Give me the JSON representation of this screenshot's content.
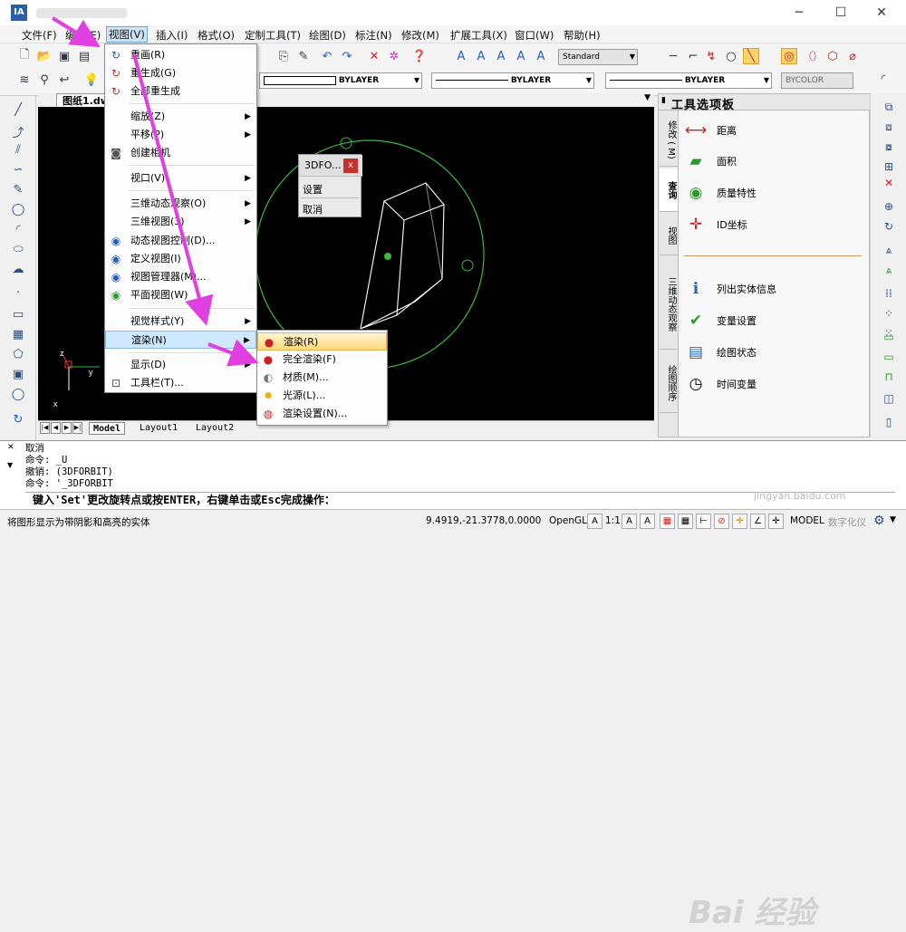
{
  "titlebar": {
    "logo": "IA",
    "min": "─",
    "max": "☐",
    "close": "✕"
  },
  "menubar": [
    "文件(F)",
    "编辑(E)",
    "视图(V)",
    "插入(I)",
    "格式(O)",
    "定制工具(T)",
    "绘图(D)",
    "标注(N)",
    "修改(M)",
    "扩展工具(X)",
    "窗口(W)",
    "帮助(H)"
  ],
  "toolbar": {
    "text_style": "Standard",
    "layer1": "BYLAYER",
    "layer2": "BYLAYER",
    "layer3": "BYLAYER",
    "color": "BYCOLOR"
  },
  "document_tab": "图纸1.dw",
  "view_menu": [
    {
      "label": "重画(R)",
      "icon": "redraw-icon"
    },
    {
      "label": "重生成(G)",
      "icon": "regen-icon"
    },
    {
      "label": "全部重生成",
      "icon": "regen-all-icon"
    },
    {
      "label": "缩放(Z)",
      "icon": "",
      "submenu": true
    },
    {
      "label": "平移(P)",
      "icon": "",
      "submenu": true
    },
    {
      "label": "创建相机",
      "icon": "camera-icon"
    },
    {
      "label": "视口(V)",
      "icon": "",
      "submenu": true
    },
    {
      "label": "三维动态观察(O)",
      "icon": "",
      "submenu": true
    },
    {
      "label": "三维视图(3)",
      "icon": "",
      "submenu": true
    },
    {
      "label": "动态视图控制(D)...",
      "icon": "dynamic-view-icon"
    },
    {
      "label": "定义视图(I)",
      "icon": "define-view-icon"
    },
    {
      "label": "视图管理器(M)...",
      "icon": "view-manager-icon"
    },
    {
      "label": "平面视图(W)",
      "icon": "plan-view-icon"
    },
    {
      "label": "视觉样式(Y)",
      "icon": "",
      "submenu": true
    },
    {
      "label": "渲染(N)",
      "icon": "",
      "submenu": true
    },
    {
      "label": "显示(D)",
      "icon": "",
      "submenu": true
    },
    {
      "label": "工具栏(T)...",
      "icon": "toolbar-icon"
    }
  ],
  "render_submenu": [
    {
      "label": "渲染(R)",
      "icon": "render-icon"
    },
    {
      "label": "完全渲染(F)",
      "icon": "full-render-icon"
    },
    {
      "label": "材质(M)...",
      "icon": "material-icon"
    },
    {
      "label": "光源(L)...",
      "icon": "light-icon"
    },
    {
      "label": "渲染设置(N)...",
      "icon": "render-settings-icon"
    }
  ],
  "popup": {
    "title": "3DFO...",
    "close": "x",
    "items": [
      "设置",
      "取消"
    ]
  },
  "palette": {
    "title": "工具选项板",
    "tabs": [
      "修改 ( M)",
      "查询",
      "视图",
      "三维动态观察",
      "绘图顺序"
    ],
    "items": [
      "距离",
      "面积",
      "质量特性",
      "ID坐标",
      "列出实体信息",
      "变量设置",
      "绘图状态",
      "时间变量"
    ]
  },
  "layout_tabs": [
    "Model",
    "Layout1",
    "Layout2"
  ],
  "command_history": [
    "取消",
    "命令: _U",
    "撤销: (3DFORBIT)",
    "命令: '_3DFORBIT"
  ],
  "prompt": "键入'Set'更改旋转点或按ENTER，右键单击或Esc完成操作：",
  "status": {
    "message": "将图形显示为带阴影和高亮的实体",
    "coords": "9.4919,-21.3778,0.0000",
    "opengl": "OpenGL",
    "scale": "1:1",
    "model": "MODEL",
    "digitize": "数字化仪"
  },
  "watermark": {
    "main": "Bai 经验",
    "sub": "jingyan.baidu.com"
  },
  "colors": {
    "arrow": "#e040e0",
    "canvas": "#000000",
    "circle": "#3db83d",
    "box": "#ffffff"
  }
}
